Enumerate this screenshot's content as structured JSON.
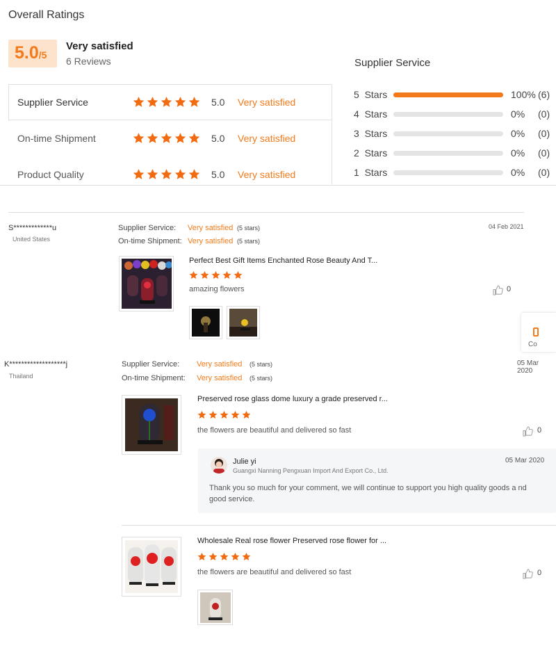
{
  "overall": {
    "title": "Overall Ratings",
    "score_big": "5.0",
    "score_small": "/5",
    "satisfaction": "Very satisfied",
    "reviews_count": "6 Reviews",
    "categories": [
      {
        "label": "Supplier Service",
        "stars": 5,
        "score": "5.0",
        "level": "Very satisfied"
      },
      {
        "label": "On-time Shipment",
        "stars": 5,
        "score": "5.0",
        "level": "Very satisfied"
      },
      {
        "label": "Product Quality",
        "stars": 5,
        "score": "5.0",
        "level": "Very satisfied"
      }
    ]
  },
  "distribution": {
    "title": "Supplier Service",
    "rows": [
      {
        "label": "5  Stars",
        "fraction": 1.0,
        "percent": "100%",
        "count": "(6)"
      },
      {
        "label": "4  Stars",
        "fraction": 0,
        "percent": "0%",
        "count": "(0)"
      },
      {
        "label": "3  Stars",
        "fraction": 0,
        "percent": "0%",
        "count": "(0)"
      },
      {
        "label": "2  Stars",
        "fraction": 0,
        "percent": "0%",
        "count": "(0)"
      },
      {
        "label": "1  Stars",
        "fraction": 0,
        "percent": "0%",
        "count": "(0)"
      }
    ]
  },
  "side_tab": {
    "label": "Co"
  },
  "reviews": [
    {
      "user": "S*************u",
      "country": "United States",
      "date": "04 Feb 2021",
      "ratings": [
        {
          "label": "Supplier Service:",
          "value": "Very satisfied",
          "stars": "(5 stars)"
        },
        {
          "label": "On-time Shipment:",
          "value": "Very satisfied",
          "stars": "(5 stars)"
        }
      ],
      "product_title": "Perfect Best Gift Items Enchanted Rose Beauty And T...",
      "product_stars": 5,
      "comment": "amazing flowers",
      "likes": "0"
    },
    {
      "user": "K*******************j",
      "country": "Thailand",
      "date": "05 Mar 2020",
      "ratings": [
        {
          "label": "Supplier Service:",
          "value": "Very satisfied",
          "stars": "(5 stars)"
        },
        {
          "label": "On-time Shipment:",
          "value": "Very satisfied",
          "stars": "(5 stars)"
        }
      ],
      "products": [
        {
          "title": "Preserved rose glass dome luxury a grade preserved r...",
          "stars": 5,
          "comment": "the flowers are beautiful and delivered so fast",
          "likes": "0"
        },
        {
          "title": "Wholesale Real rose flower Preserved rose flower for ...",
          "stars": 5,
          "comment": "the flowers are beautiful and delivered so fast",
          "likes": "0"
        }
      ],
      "reply": {
        "name": "Julie yi",
        "company": "Guangxi Nanning Pengxuan Import And Export Co., Ltd.",
        "date": "05 Mar 2020",
        "text": "Thank you  so much for your comment, we will continue to support you high  quality  goods  a nd  good service."
      }
    }
  ],
  "colors": {
    "accent": "#f27a1a",
    "score_bg": "#fde3cc",
    "bar_track": "#e4e4e4",
    "reply_bg": "#f4f6f8"
  },
  "icons": [
    "star-icon",
    "thumbs-up-icon",
    "avatar"
  ]
}
